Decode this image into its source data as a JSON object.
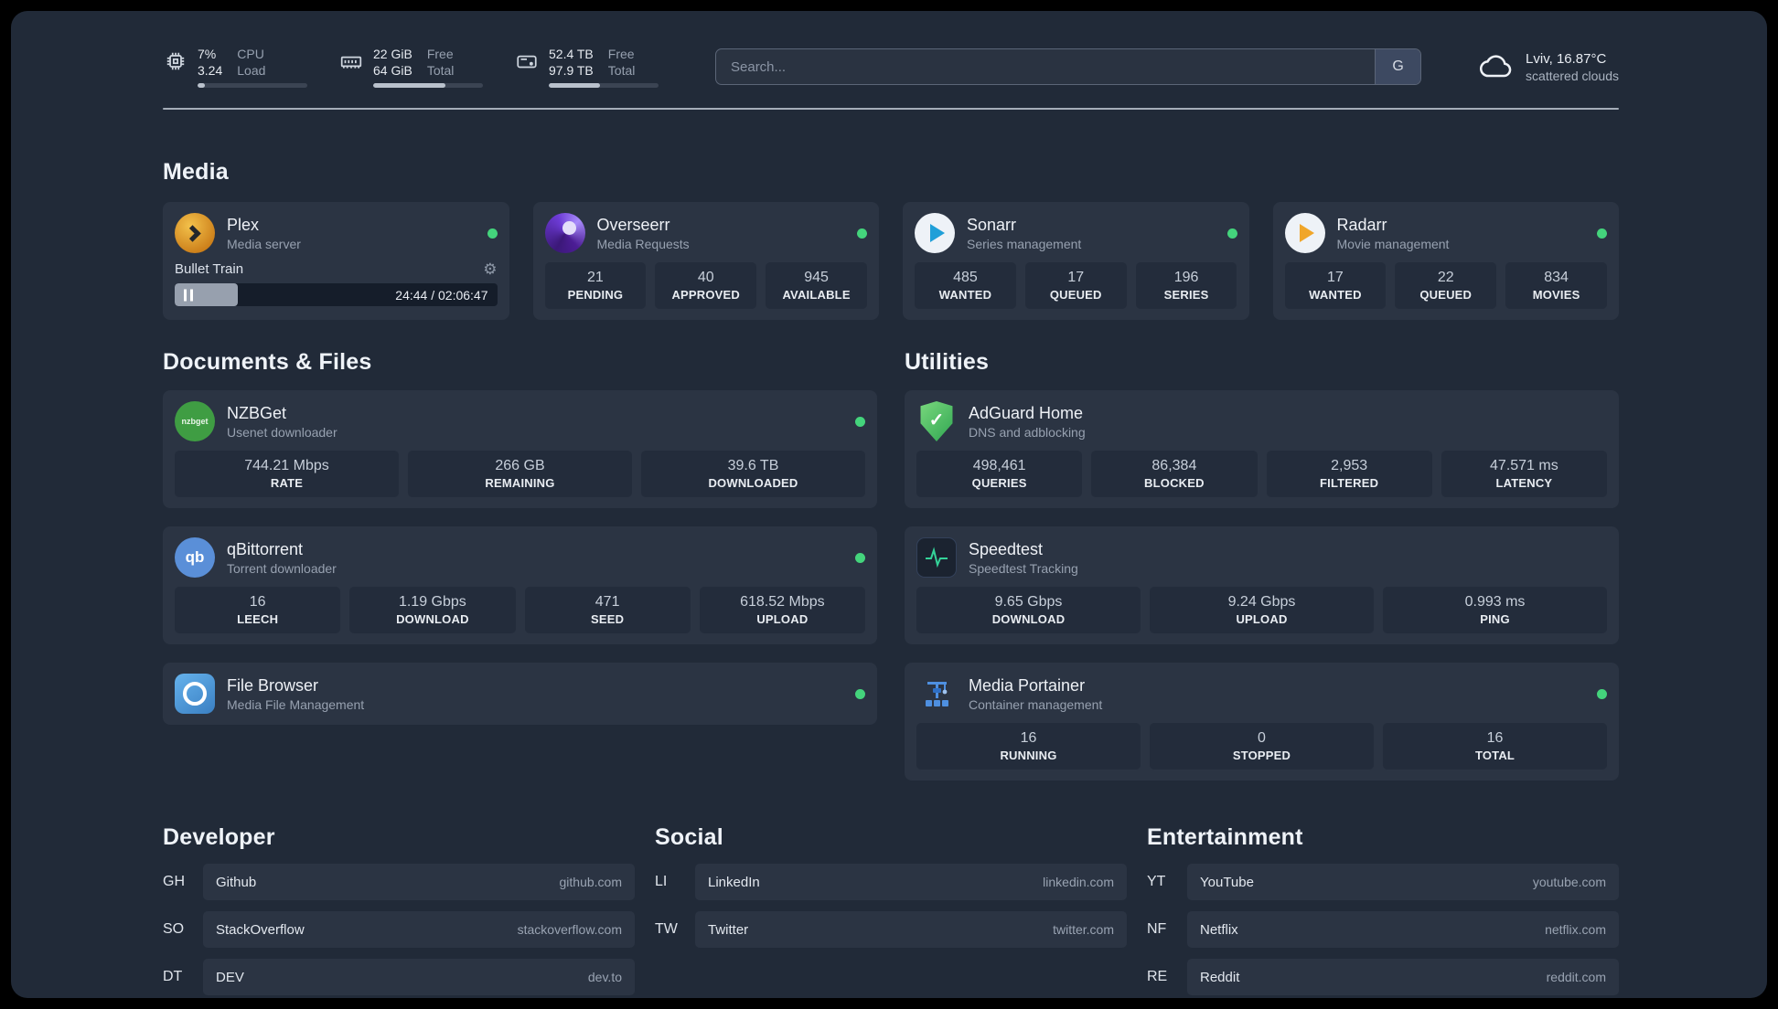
{
  "topbar": {
    "cpu": {
      "percent": "7%",
      "load": "3.24",
      "label_top": "CPU",
      "label_bottom": "Load",
      "bar_percent": 7
    },
    "ram": {
      "free": "22 GiB",
      "total": "64 GiB",
      "label_top": "Free",
      "label_bottom": "Total",
      "bar_percent": 66
    },
    "disk": {
      "free": "52.4 TB",
      "total": "97.9 TB",
      "label_top": "Free",
      "label_bottom": "Total",
      "bar_percent": 47
    },
    "search": {
      "placeholder": "Search...",
      "provider_button": "G"
    },
    "weather": {
      "location": "Lviv, 16.87°C",
      "condition": "scattered clouds"
    }
  },
  "colors": {
    "status_online": "#44d47c",
    "card_background": "#2b3443",
    "page_background": "#212a38"
  },
  "sections": {
    "media": {
      "title": "Media",
      "services": [
        {
          "name": "Plex",
          "desc": "Media server",
          "status": "online",
          "player": {
            "title": "Bullet Train",
            "time": "24:44 / 02:06:47",
            "progress_percent": 19.5
          }
        },
        {
          "name": "Overseerr",
          "desc": "Media Requests",
          "status": "online",
          "stats": [
            {
              "value": "21",
              "label": "PENDING"
            },
            {
              "value": "40",
              "label": "APPROVED"
            },
            {
              "value": "945",
              "label": "AVAILABLE"
            }
          ]
        },
        {
          "name": "Sonarr",
          "desc": "Series management",
          "status": "online",
          "stats": [
            {
              "value": "485",
              "label": "WANTED"
            },
            {
              "value": "17",
              "label": "QUEUED"
            },
            {
              "value": "196",
              "label": "SERIES"
            }
          ]
        },
        {
          "name": "Radarr",
          "desc": "Movie management",
          "status": "online",
          "stats": [
            {
              "value": "17",
              "label": "WANTED"
            },
            {
              "value": "22",
              "label": "QUEUED"
            },
            {
              "value": "834",
              "label": "MOVIES"
            }
          ]
        }
      ]
    },
    "documents": {
      "title": "Documents & Files",
      "services": [
        {
          "name": "NZBGet",
          "desc": "Usenet downloader",
          "status": "online",
          "stats": [
            {
              "value": "744.21 Mbps",
              "label": "RATE"
            },
            {
              "value": "266 GB",
              "label": "REMAINING"
            },
            {
              "value": "39.6 TB",
              "label": "DOWNLOADED"
            }
          ]
        },
        {
          "name": "qBittorrent",
          "desc": "Torrent downloader",
          "status": "online",
          "stats": [
            {
              "value": "16",
              "label": "LEECH"
            },
            {
              "value": "1.19 Gbps",
              "label": "DOWNLOAD"
            },
            {
              "value": "471",
              "label": "SEED"
            },
            {
              "value": "618.52 Mbps",
              "label": "UPLOAD"
            }
          ]
        },
        {
          "name": "File Browser",
          "desc": "Media File Management",
          "status": "online"
        }
      ]
    },
    "utilities": {
      "title": "Utilities",
      "services": [
        {
          "name": "AdGuard Home",
          "desc": "DNS and adblocking",
          "stats": [
            {
              "value": "498,461",
              "label": "QUERIES"
            },
            {
              "value": "86,384",
              "label": "BLOCKED"
            },
            {
              "value": "2,953",
              "label": "FILTERED"
            },
            {
              "value": "47.571 ms",
              "label": "LATENCY"
            }
          ]
        },
        {
          "name": "Speedtest",
          "desc": "Speedtest Tracking",
          "stats": [
            {
              "value": "9.65 Gbps",
              "label": "DOWNLOAD"
            },
            {
              "value": "9.24 Gbps",
              "label": "UPLOAD"
            },
            {
              "value": "0.993 ms",
              "label": "PING"
            }
          ]
        },
        {
          "name": "Media Portainer",
          "desc": "Container management",
          "status": "online",
          "stats": [
            {
              "value": "16",
              "label": "RUNNING"
            },
            {
              "value": "0",
              "label": "STOPPED"
            },
            {
              "value": "16",
              "label": "TOTAL"
            }
          ]
        }
      ]
    }
  },
  "bookmarks": {
    "developer": {
      "title": "Developer",
      "items": [
        {
          "abbr": "GH",
          "name": "Github",
          "url": "github.com"
        },
        {
          "abbr": "SO",
          "name": "StackOverflow",
          "url": "stackoverflow.com"
        },
        {
          "abbr": "DT",
          "name": "DEV",
          "url": "dev.to"
        }
      ]
    },
    "social": {
      "title": "Social",
      "items": [
        {
          "abbr": "LI",
          "name": "LinkedIn",
          "url": "linkedin.com"
        },
        {
          "abbr": "TW",
          "name": "Twitter",
          "url": "twitter.com"
        }
      ]
    },
    "entertainment": {
      "title": "Entertainment",
      "items": [
        {
          "abbr": "YT",
          "name": "YouTube",
          "url": "youtube.com"
        },
        {
          "abbr": "NF",
          "name": "Netflix",
          "url": "netflix.com"
        },
        {
          "abbr": "RE",
          "name": "Reddit",
          "url": "reddit.com"
        }
      ]
    }
  }
}
